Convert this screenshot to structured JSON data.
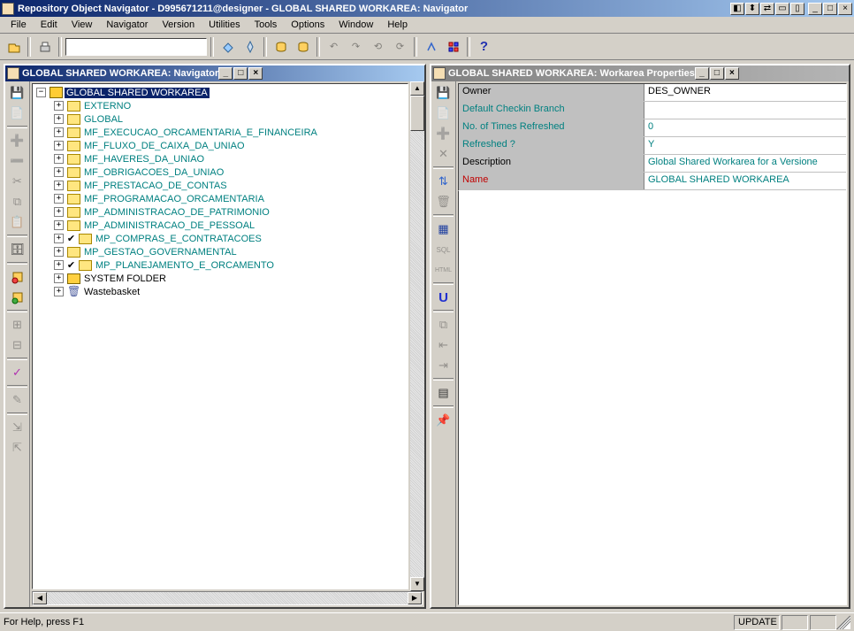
{
  "app": {
    "title": "Repository Object Navigator - D995671211@designer - GLOBAL SHARED WORKAREA: Navigator"
  },
  "menu": [
    "File",
    "Edit",
    "View",
    "Navigator",
    "Version",
    "Utilities",
    "Tools",
    "Options",
    "Window",
    "Help"
  ],
  "toolbar": {
    "search_value": ""
  },
  "navWindow": {
    "title": "GLOBAL SHARED WORKAREA: Navigator",
    "tree": {
      "root": "GLOBAL SHARED WORKAREA",
      "items": [
        {
          "label": "EXTERNO",
          "type": "folder"
        },
        {
          "label": "GLOBAL",
          "type": "folder"
        },
        {
          "label": "MF_EXECUCAO_ORCAMENTARIA_E_FINANCEIRA",
          "type": "folder"
        },
        {
          "label": "MF_FLUXO_DE_CAIXA_DA_UNIAO",
          "type": "folder"
        },
        {
          "label": "MF_HAVERES_DA_UNIAO",
          "type": "folder"
        },
        {
          "label": "MF_OBRIGACOES_DA_UNIAO",
          "type": "folder"
        },
        {
          "label": "MF_PRESTACAO_DE_CONTAS",
          "type": "folder"
        },
        {
          "label": "MF_PROGRAMACAO_ORCAMENTARIA",
          "type": "folder"
        },
        {
          "label": "MP_ADMINISTRACAO_DE_PATRIMONIO",
          "type": "folder"
        },
        {
          "label": "MP_ADMINISTRACAO_DE_PESSOAL",
          "type": "folder"
        },
        {
          "label": "MP_COMPRAS_E_CONTRATACOES",
          "type": "folderchk"
        },
        {
          "label": "MP_GESTAO_GOVERNAMENTAL",
          "type": "folder"
        },
        {
          "label": "MP_PLANEJAMENTO_E_ORCAMENTO",
          "type": "folderchk"
        },
        {
          "label": "SYSTEM FOLDER",
          "type": "sysfolder"
        },
        {
          "label": "Wastebasket",
          "type": "trash"
        }
      ]
    }
  },
  "propWindow": {
    "title": "GLOBAL SHARED WORKAREA: Workarea Properties",
    "rows": [
      {
        "key": "Owner",
        "keyStyle": "black",
        "val": "DES_OWNER",
        "valStyle": "black"
      },
      {
        "key": "Default Checkin Branch",
        "keyStyle": "",
        "val": "",
        "valStyle": ""
      },
      {
        "key": "No. of Times Refreshed",
        "keyStyle": "",
        "val": "0",
        "valStyle": ""
      },
      {
        "key": "Refreshed ?",
        "keyStyle": "",
        "val": "Y",
        "valStyle": ""
      },
      {
        "key": "Description",
        "keyStyle": "black",
        "val": "Global Shared Workarea for a Versione",
        "valStyle": ""
      },
      {
        "key": "Name",
        "keyStyle": "red",
        "val": "GLOBAL SHARED WORKAREA",
        "valStyle": ""
      }
    ]
  },
  "status": {
    "help": "For Help, press F1",
    "mode": "UPDATE"
  }
}
